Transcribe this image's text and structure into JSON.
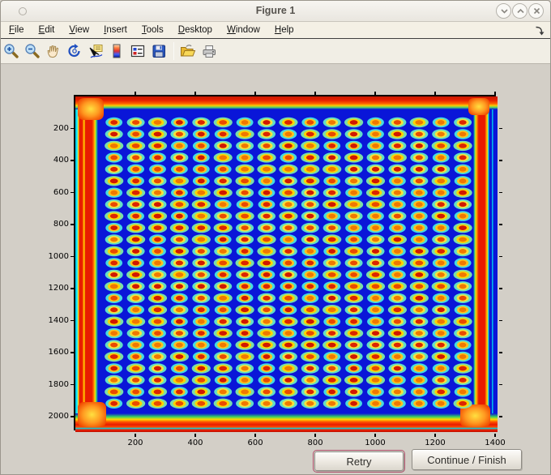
{
  "window": {
    "title": "Figure 1",
    "controls": {
      "minimize": "chevron-down",
      "maximize": "chevron-up",
      "close": "x"
    }
  },
  "menubar": {
    "items": [
      {
        "label": "File"
      },
      {
        "label": "Edit"
      },
      {
        "label": "View"
      },
      {
        "label": "Insert"
      },
      {
        "label": "Tools"
      },
      {
        "label": "Desktop"
      },
      {
        "label": "Window"
      },
      {
        "label": "Help"
      }
    ],
    "dock_icon": "dock-figure-arrow"
  },
  "toolbar": {
    "tools": [
      "zoom-in",
      "zoom-out",
      "pan",
      "rotate-3d",
      "data-cursor",
      "insert-colorbar",
      "insert-legend",
      "save-figure",
      "open-file",
      "print-figure"
    ]
  },
  "buttons": {
    "retry": "Retry",
    "continue": "Continue / Finish"
  },
  "chart_data": {
    "type": "heatmap",
    "title": "",
    "xlabel": "",
    "ylabel": "",
    "x_ticks": [
      200,
      400,
      600,
      800,
      1000,
      1200,
      1400
    ],
    "y_ticks": [
      200,
      400,
      600,
      800,
      1000,
      1200,
      1400,
      1600,
      1800,
      2000
    ],
    "x_range": [
      0,
      1408
    ],
    "y_range": [
      0,
      2095
    ],
    "colormap": "jet",
    "description": "Scanned microarray plate rendered with jet colormap: blue field, grid of red/orange spots with yellow rings and cyan halos, saturated red borders on all four edges with orange corner blobs",
    "spot_grid": {
      "cols": 17,
      "rows": 25,
      "x_first": 129,
      "x_last": 1292,
      "y_first": 162,
      "y_last": 1917,
      "spot_radius_data": 30
    },
    "colors": {
      "field_blue": "#0a16d8",
      "halo_cyan": [
        "#49e6e2",
        "#66e9c6",
        "#7fe9a6"
      ],
      "ring_yellow": [
        "#ffd400",
        "#ffc31e",
        "#f6e23c"
      ],
      "core_red": [
        "#dc2500",
        "#e94a00",
        "#f07800",
        "#d01800"
      ],
      "band_red": "#e81c00",
      "band_orange": "#ff8c00",
      "band_yellow": "#ffd800",
      "band_cyan": "#00e0f0",
      "band_green": "#38d860",
      "blob_orange": "#ff9820"
    }
  }
}
